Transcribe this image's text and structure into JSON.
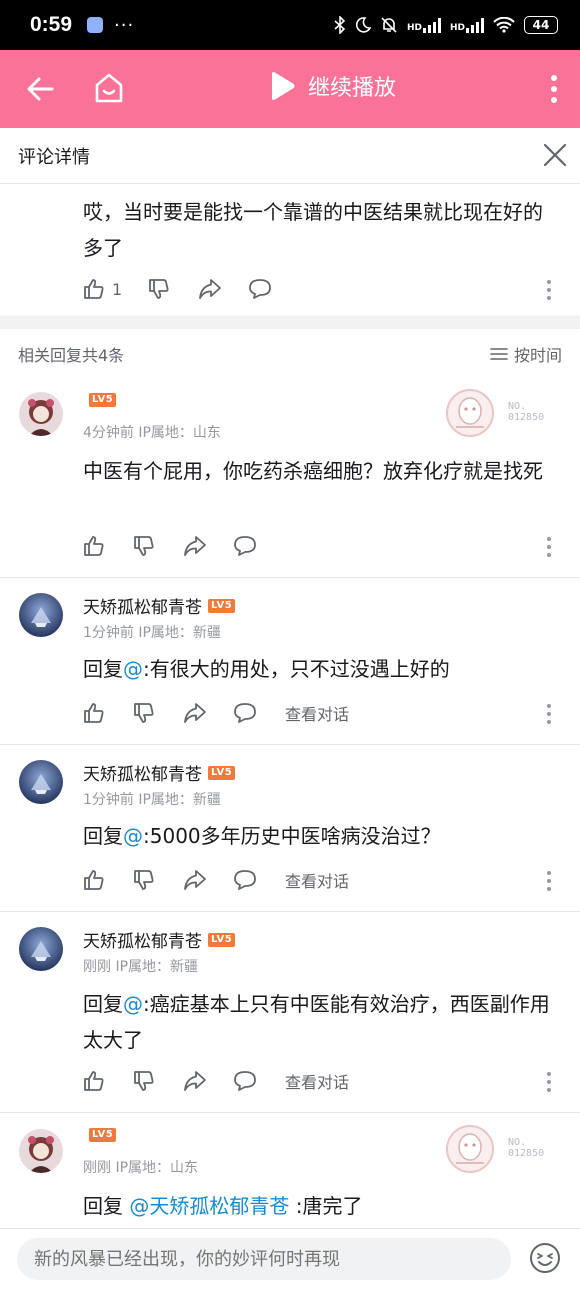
{
  "status_bar": {
    "time": "0:59",
    "dots": "···",
    "hd1": "HD",
    "hd2": "HD",
    "battery": "44"
  },
  "app_bar": {
    "continue_play": "继续播放"
  },
  "detail_header": {
    "title": "评论详情"
  },
  "main_comment": {
    "text": "哎，当时要是能找一个靠谱的中医结果就比现在好的多了",
    "like_count": "1"
  },
  "replies_bar": {
    "count_text": "相关回复共4条",
    "sort_label": "按时间"
  },
  "replies": [
    {
      "username": "",
      "level": "LV5",
      "meta": "4分钟前 IP属地：山东",
      "text": "中医有个屁用，你吃药杀癌细胞？放弃化疗就是找死",
      "badge_number": "NO.\n012850"
    },
    {
      "username": "天矫孤松郁青苍",
      "level": "LV5",
      "meta": "1分钟前 IP属地：新疆",
      "reply_prefix": "回复",
      "mention": "@",
      "text": ":有很大的用处，只不过没遇上好的",
      "view_conversation": "查看对话"
    },
    {
      "username": "天矫孤松郁青苍",
      "level": "LV5",
      "meta": "1分钟前 IP属地：新疆",
      "reply_prefix": "回复",
      "mention": "@",
      "text": ":5000多年历史中医啥病没治过？",
      "view_conversation": "查看对话"
    },
    {
      "username": "天矫孤松郁青苍",
      "level": "LV5",
      "meta": "刚刚 IP属地：新疆",
      "reply_prefix": "回复",
      "mention": "@",
      "text": ":癌症基本上只有中医能有效治疗，西医副作用太大了",
      "view_conversation": "查看对话"
    },
    {
      "username": "",
      "level": "LV5",
      "meta": "刚刚 IP属地：山东",
      "reply_prefix": "回复",
      "mention": "@天矫孤松郁青苍",
      "text": ":唐完了",
      "badge_number": "NO.\n012850"
    }
  ],
  "input": {
    "placeholder": "新的风暴已经出现，你的妙评何时再现"
  },
  "colors": {
    "brand_pink": "#fb7299",
    "level_orange": "#f07a3a",
    "mention_blue": "#178bcf"
  }
}
